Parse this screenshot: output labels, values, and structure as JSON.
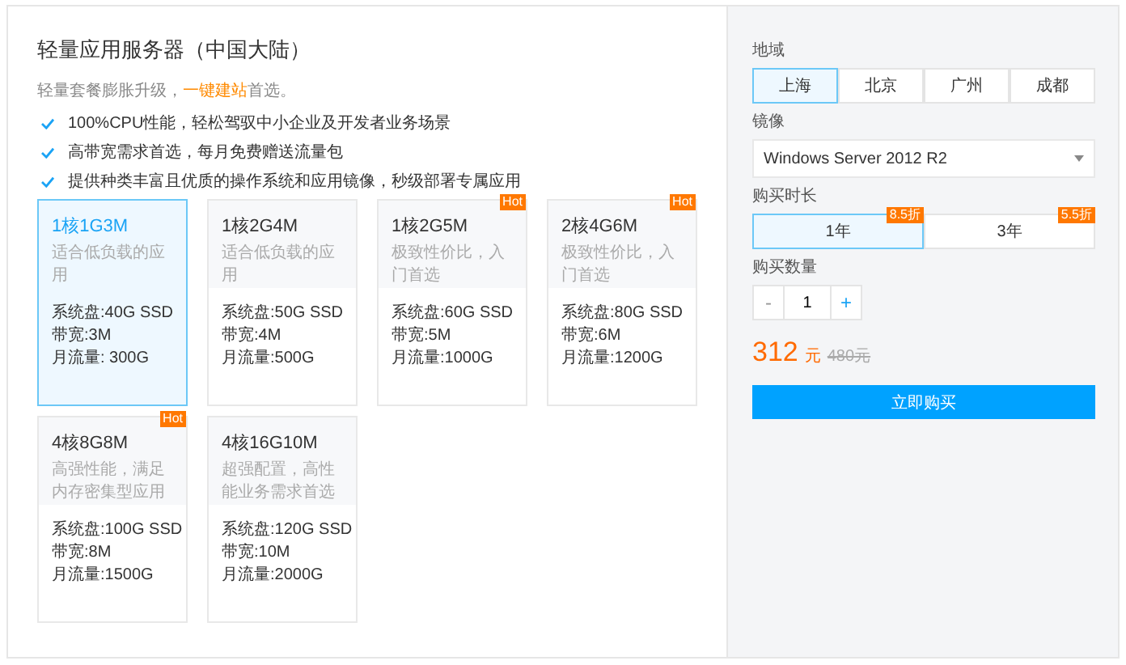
{
  "title": "轻量应用服务器（中国大陆）",
  "subtitle": {
    "before": "轻量套餐膨胀升级，",
    "link": "一键建站",
    "after": "首选。"
  },
  "features": [
    "100%CPU性能，轻松驾驭中小企业及开发者业务场景",
    "高带宽需求首选，每月免费赠送流量包",
    "提供种类丰富且优质的操作系统和应用镜像，秒级部署专属应用"
  ],
  "plans": [
    {
      "name": "1核1G3M",
      "desc": "适合低负载的应用",
      "specs": [
        "系统盘:40G SSD",
        "带宽:3M",
        "月流量: 300G"
      ],
      "selected": true
    },
    {
      "name": "1核2G4M",
      "desc": "适合低负载的应用",
      "specs": [
        "系统盘:50G SSD",
        "带宽:4M",
        "月流量:500G"
      ],
      "selected": false
    },
    {
      "name": "1核2G5M",
      "desc": "极致性价比，入门首选",
      "specs": [
        "系统盘:60G SSD",
        "带宽:5M",
        "月流量:1000G"
      ],
      "hot_label": "Hot",
      "selected": false
    },
    {
      "name": "2核4G6M",
      "desc": "极致性价比，入门首选",
      "specs": [
        "系统盘:80G SSD",
        "带宽:6M",
        "月流量:1200G"
      ],
      "hot_label": "Hot",
      "selected": false
    },
    {
      "name": "4核8G8M",
      "desc": "高强性能，满足内存密集型应用",
      "specs": [
        "系统盘:100G SSD",
        "带宽:8M",
        "月流量:1500G"
      ],
      "hot_label": "Hot",
      "selected": false
    },
    {
      "name": "4核16G10M",
      "desc": "超强配置，高性能业务需求首选",
      "specs": [
        "系统盘:120G SSD",
        "带宽:10M",
        "月流量:2000G"
      ],
      "selected": false
    }
  ],
  "region": {
    "label": "地域",
    "options": [
      {
        "label": "上海",
        "selected": true
      },
      {
        "label": "北京",
        "selected": false
      },
      {
        "label": "广州",
        "selected": false
      },
      {
        "label": "成都",
        "selected": false
      }
    ]
  },
  "image": {
    "label": "镜像",
    "value": "Windows Server 2012 R2"
  },
  "duration": {
    "label": "购买时长",
    "options": [
      {
        "label": "1年",
        "badge": "8.5折",
        "selected": true
      },
      {
        "label": "3年",
        "badge": "5.5折",
        "selected": false
      }
    ]
  },
  "quantity": {
    "label": "购买数量",
    "minus": "-",
    "value": "1",
    "plus": "+"
  },
  "price": {
    "amount": "312",
    "unit": "元",
    "original": "480元"
  },
  "buy_button": "立即购买"
}
